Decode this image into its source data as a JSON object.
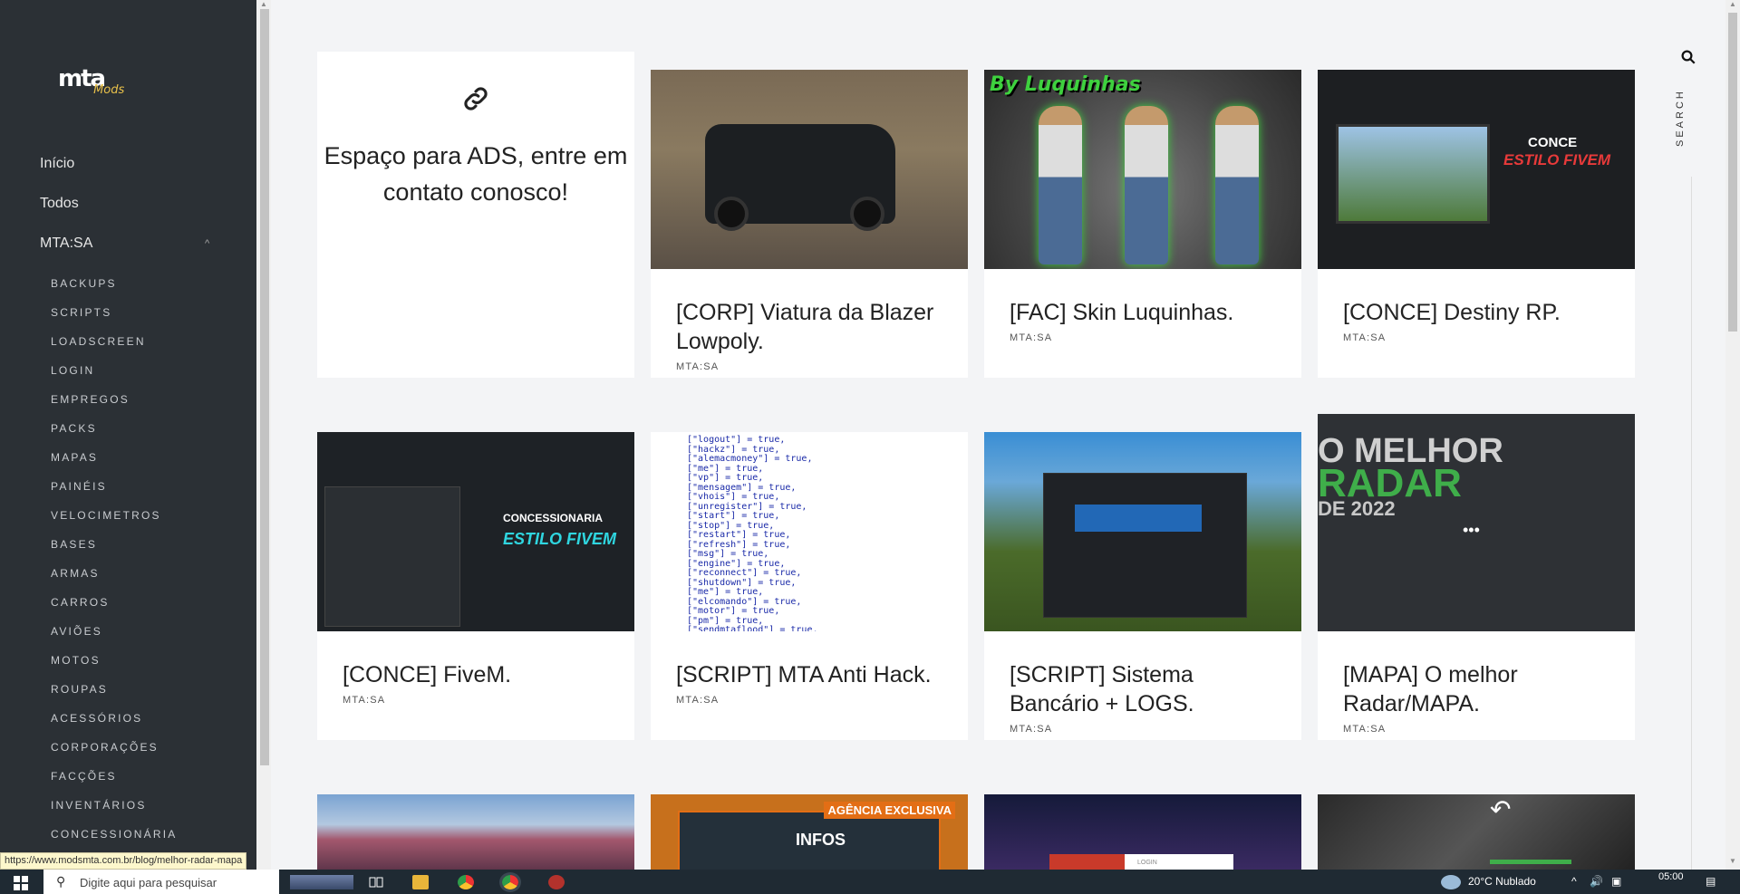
{
  "sidebar": {
    "logo_main": "mta",
    "logo_sub": "Mods",
    "main_items": [
      {
        "label": "Início"
      },
      {
        "label": "Todos"
      },
      {
        "label": "MTA:SA"
      }
    ],
    "sub_items": [
      "BACKUPS",
      "SCRIPTS",
      "LOADSCREEN",
      "LOGIN",
      "EMPREGOS",
      "PACKS",
      "MAPAS",
      "PAINÉIS",
      "VELOCIMETROS",
      "BASES",
      "ARMAS",
      "CARROS",
      "AVIÕES",
      "MOTOS",
      "ROUPAS",
      "ACESSÓRIOS",
      "CORPORAÇÕES",
      "FACÇÕES",
      "INVENTÁRIOS",
      "CONCESSIONÁRIA"
    ]
  },
  "ads": {
    "icon": "link-icon",
    "text": "Espaço para ADS, entre em contato conosco!"
  },
  "posts": [
    {
      "title": "[CORP] Viatura da Blazer Lowpoly.",
      "category": "MTA:SA"
    },
    {
      "title": "[FAC] Skin Luquinhas.",
      "category": "MTA:SA",
      "thumb_text": "By Luquinhas"
    },
    {
      "title": "[CONCE] Destiny RP.",
      "category": "MTA:SA",
      "thumb_text": "CONCE",
      "thumb_text2": "ESTILO FIVEM"
    },
    {
      "title": "[CONCE] FiveM.",
      "category": "MTA:SA",
      "thumb_text": "CONCESSIONARIA",
      "thumb_text2": "ESTILO FIVEM"
    },
    {
      "title": "[SCRIPT] MTA Anti Hack.",
      "category": "MTA:SA"
    },
    {
      "title": "[SCRIPT] Sistema Bancário + LOGS.",
      "category": "MTA:SA"
    },
    {
      "title": "[MAPA] O melhor Radar/MAPA.",
      "category": "MTA:SA",
      "thumb_text": "O MELHOR",
      "thumb_text2": "RADAR",
      "thumb_text3": "DE 2022"
    }
  ],
  "row3": {
    "infos_badge": "AGÊNCIA EXCLUSIVA",
    "infos_title": "INFOS",
    "login_text": "LOGIN"
  },
  "code_lines": "[\"logout\"] = true,\n[\"hackz\"] = true,\n[\"alemacmoney\"] = true,\n[\"me\"] = true,\n[\"vp\"] = true,\n[\"mensagem\"] = true,\n[\"vhois\"] = true,\n[\"unregister\"] = true,\n[\"start\"] = true,\n[\"stop\"] = true,\n[\"restart\"] = true,\n[\"refresh\"] = true,\n[\"msg\"] = true,\n[\"engine\"] = true,\n[\"reconnect\"] = true,\n[\"shutdown\"] = true,\n[\"me\"] = true,\n[\"elcomando\"] = true,\n[\"motor\"] = true,\n[\"pm\"] = true,\n[\"sendmtaflood\"] = true,",
  "rail": {
    "search_label": "SEARCH"
  },
  "status_url": "https://www.modsmta.com.br/blog/melhor-radar-mapa",
  "taskbar": {
    "search_placeholder": "Digite aqui para pesquisar",
    "weather": "20°C  Nublado",
    "time": "05:00"
  }
}
